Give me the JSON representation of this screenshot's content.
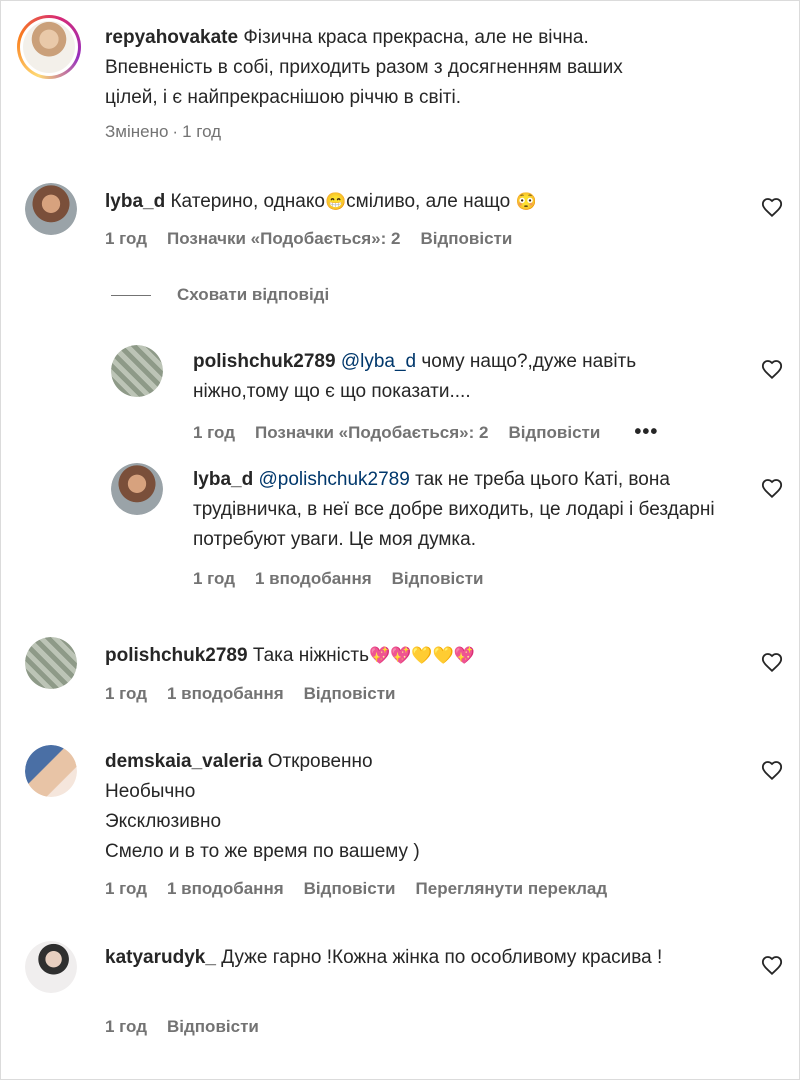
{
  "comments": [
    {
      "username": "repyahovakate",
      "text": "Фізична краса прекрасна, але не вічна. Впевненість в собі, приходить разом з досягненням ваших цілей, і є найпрекраснішою річчю в світі.",
      "meta": [
        "Змінено",
        "1 год"
      ]
    },
    {
      "username": "lyba_d",
      "text_before": "Катерино, однако",
      "text_after": "сміливо, але нащо",
      "time": "1 год",
      "likes": "Позначки «Подобається»: 2",
      "reply": "Відповісти"
    },
    {
      "username": "polishchuk2789",
      "text": "Така ніжність",
      "time": "1 год",
      "likes": "1 вподобання",
      "reply": "Відповісти"
    },
    {
      "username": "demskaia_valeria",
      "lines": [
        "Откровенно",
        "Необычно",
        "Эксклюзивно",
        "Смело и в то же время по вашему )"
      ],
      "time": "1 год",
      "likes": "1 вподобання",
      "reply": "Відповісти",
      "translate": "Переглянути переклад"
    },
    {
      "username": "katyarudyk_",
      "text": "Дуже гарно !Кожна жінка по особливому красива !",
      "time": "1 год",
      "reply": "Відповісти"
    }
  ],
  "hide_replies": "Сховати відповіді",
  "replies": [
    {
      "username": "polishchuk2789",
      "mention": "@lyba_d",
      "text": "чому нащо?,дуже навіть ніжно,тому що є що показати....",
      "time": "1 год",
      "likes": "Позначки «Подобається»: 2",
      "reply": "Відповісти",
      "more": "•••"
    },
    {
      "username": "lyba_d",
      "mention": "@polishchuk2789",
      "text": "так не треба цього Каті, вона трудівничка, в неї все добре виходить, це лодарі і бездарні потребуют уваги. Це моя думка.",
      "time": "1 год",
      "likes": "1 вподобання",
      "reply": "Відповісти"
    }
  ],
  "colors": {
    "text": "#262626",
    "meta": "#737373",
    "mention": "#00376b"
  }
}
